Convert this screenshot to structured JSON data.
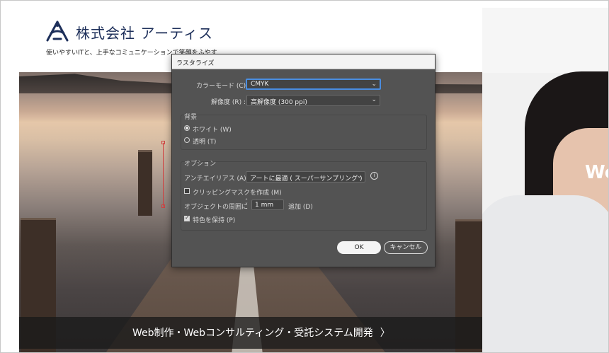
{
  "website": {
    "company_name": "株式会社 アーティス",
    "tagline": "使いやすいITと、上手なコミュニケーションで笑顔をふやす",
    "bottom_link": "Web制作・Webコンサルティング・受託システム開発",
    "bottom_chevron": "〉",
    "right_heading": "We"
  },
  "dialog": {
    "title": "ラスタライズ",
    "color_mode": {
      "label": "カラーモード (C) :",
      "value": "CMYK"
    },
    "resolution": {
      "label": "解像度 (R) :",
      "value": "高解像度 (300 ppi)"
    },
    "background": {
      "title": "背景",
      "options": [
        {
          "label": "ホワイト (W)",
          "selected": true
        },
        {
          "label": "透明 (T)",
          "selected": false
        }
      ]
    },
    "options": {
      "title": "オプション",
      "antialias": {
        "label": "アンチエイリアス (A) :",
        "value": "アートに最適 ( スーパーサンプリング )"
      },
      "clipping_mask": {
        "label": "クリッピングマスクを作成 (M)",
        "checked": false
      },
      "add_around": {
        "label": "オブジェクトの周囲に",
        "value": "1 mm",
        "suffix": "追加 (D)"
      },
      "preserve_spot": {
        "label": "特色を保持 (P)",
        "checked": true
      }
    },
    "ok_label": "OK",
    "cancel_label": "キャンセル"
  },
  "icons": {
    "dropdown": "chevron-down-icon",
    "info": "info-icon",
    "stepper": "stepper-icon",
    "logo": "logo-icon"
  }
}
